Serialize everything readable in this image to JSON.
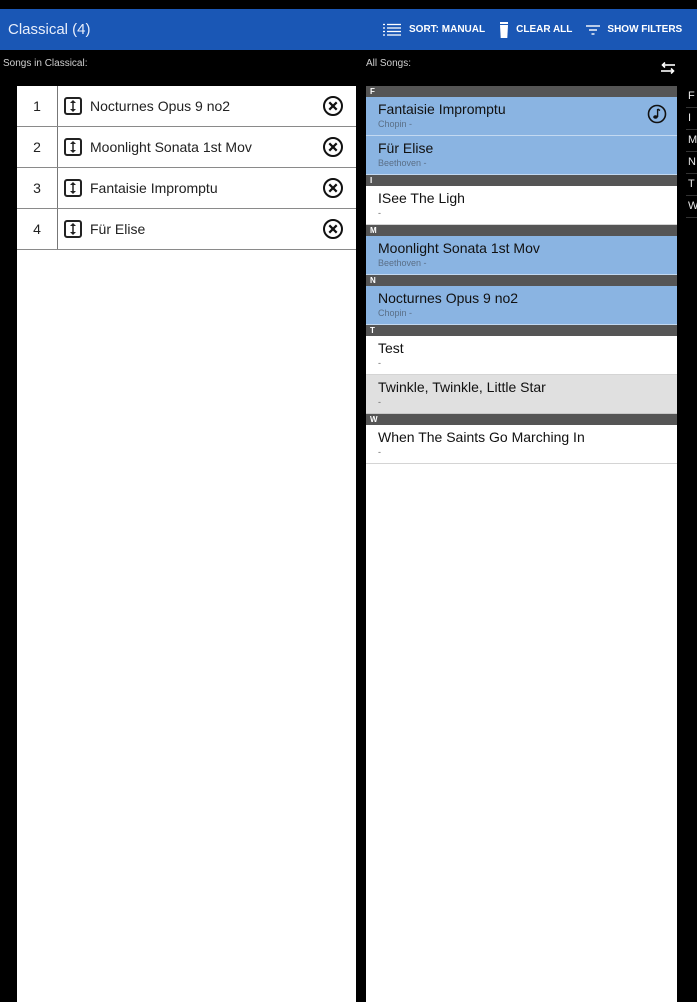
{
  "app": {
    "title": "Classical (4)"
  },
  "actions": {
    "sort": "SORT: MANUAL",
    "clear": "CLEAR ALL",
    "filters": "SHOW FILTERS"
  },
  "labels": {
    "left": "Songs in Classical:",
    "right": "All Songs:"
  },
  "playlist": [
    {
      "num": "1",
      "title": "Nocturnes Opus 9 no2"
    },
    {
      "num": "2",
      "title": "Moonlight Sonata 1st Mov"
    },
    {
      "num": "3",
      "title": "Fantaisie Impromptu"
    },
    {
      "num": "4",
      "title": "Für Elise"
    }
  ],
  "all_songs": {
    "sections": [
      {
        "letter": "F",
        "songs": [
          {
            "title": "Fantaisie Impromptu",
            "artist": "Chopin -",
            "state": "selected",
            "playing": true
          },
          {
            "title": "Für Elise",
            "artist": "Beethoven -",
            "state": "selected"
          }
        ]
      },
      {
        "letter": "I",
        "songs": [
          {
            "title": "ISee The Ligh",
            "artist": "-",
            "state": "normal"
          }
        ]
      },
      {
        "letter": "M",
        "songs": [
          {
            "title": "Moonlight Sonata 1st Mov",
            "artist": "Beethoven -",
            "state": "selected"
          }
        ]
      },
      {
        "letter": "N",
        "songs": [
          {
            "title": "Nocturnes Opus 9 no2",
            "artist": "Chopin -",
            "state": "selected"
          }
        ]
      },
      {
        "letter": "T",
        "songs": [
          {
            "title": "Test",
            "artist": "-",
            "state": "normal"
          },
          {
            "title": "Twinkle, Twinkle, Little Star",
            "artist": "-",
            "state": "highlighted"
          }
        ]
      },
      {
        "letter": "W",
        "songs": [
          {
            "title": "When The Saints Go Marching In",
            "artist": "-",
            "state": "normal"
          }
        ]
      }
    ]
  },
  "index_letters": [
    "F",
    "I",
    "M",
    "N",
    "T",
    "W"
  ],
  "icons": {
    "sort": "sort-lines-icon",
    "clear": "trash-icon",
    "filters": "filter-icon",
    "remove": "remove-circle-icon",
    "drag": "drag-handle-icon",
    "playing": "music-note-icon",
    "toggle": "swap-list-icon"
  },
  "colors": {
    "actionbar": "#1a57b5",
    "selected": "#8ab4e2",
    "highlighted": "#e0e0e0",
    "section_header": "#555555"
  }
}
